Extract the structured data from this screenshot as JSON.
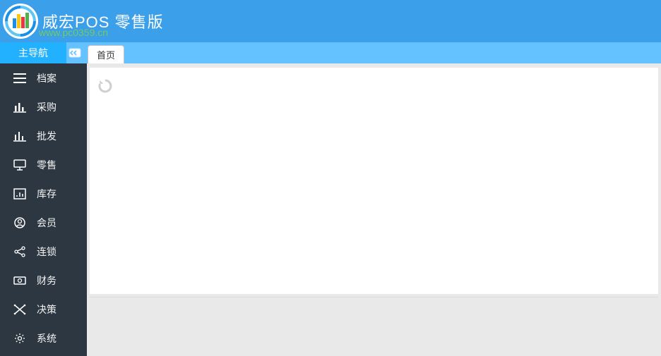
{
  "header": {
    "title": "威宏POS 零售版",
    "watermark": "www.pc0359.cn"
  },
  "nav": {
    "main_label": "主导航",
    "tabs": [
      {
        "label": "首页"
      }
    ]
  },
  "sidebar": {
    "items": [
      {
        "icon": "lines-icon",
        "label": "档案"
      },
      {
        "icon": "bars-icon",
        "label": "采购"
      },
      {
        "icon": "bars2-icon",
        "label": "批发"
      },
      {
        "icon": "monitor-icon",
        "label": "零售"
      },
      {
        "icon": "chart-icon",
        "label": "库存"
      },
      {
        "icon": "user-icon",
        "label": "会员"
      },
      {
        "icon": "share-icon",
        "label": "连锁"
      },
      {
        "icon": "money-icon",
        "label": "财务"
      },
      {
        "icon": "cross-icon",
        "label": "决策"
      },
      {
        "icon": "gear-icon",
        "label": "系统"
      }
    ]
  },
  "colors": {
    "header_bg": "#3ba0e9",
    "navbar_bg": "#63c2ff",
    "navbar_active": "#22b1ff",
    "sidebar_bg": "#2d3741"
  }
}
